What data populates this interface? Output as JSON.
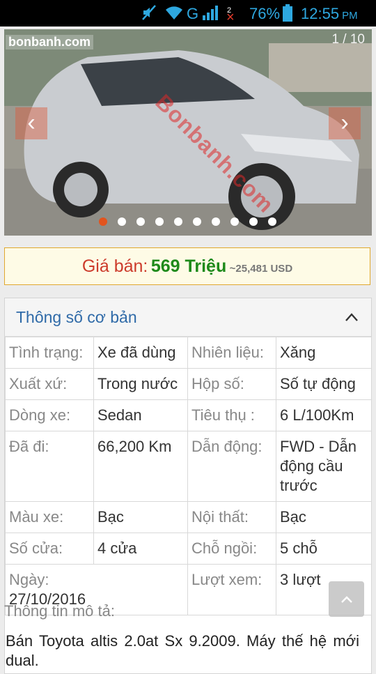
{
  "status": {
    "battery": "76%",
    "time": "12:55",
    "ampm": "PM",
    "network": "G",
    "sim_badge": "2"
  },
  "icons": {
    "mute": "volume-muted-icon",
    "wifi": "wifi-icon",
    "signal": "signal-bars-icon",
    "battery": "battery-icon",
    "prev": "chevron-left-icon",
    "next": "chevron-right-icon",
    "collapse": "chevron-up-icon",
    "scroll_top": "arrow-up-icon"
  },
  "gallery": {
    "counter": "1 / 10",
    "logo": "bonbanh.com",
    "watermark": "Bonbanh.com",
    "slide_count": 10,
    "active_slide": 1
  },
  "price": {
    "label": "Giá bán:",
    "value": "569 Triệu",
    "usd": "~25,481 USD"
  },
  "colors": {
    "accent_blue": "#2f6aa8",
    "price_green": "#1e8a1a",
    "label_red": "#cc3b2b",
    "active_dot": "#e2541e"
  },
  "specs": {
    "title": "Thông số cơ bản",
    "rows": [
      {
        "k1": "Tình trạng:",
        "v1": "Xe đã dùng",
        "k2": "Nhiên liệu:",
        "v2": "Xăng"
      },
      {
        "k1": "Xuất xứ:",
        "v1": "Trong nước",
        "k2": "Hộp số:",
        "v2": "Số tự động"
      },
      {
        "k1": "Dòng xe:",
        "v1": "Sedan",
        "k2": "Tiêu thụ :",
        "v2": "6 L/100Km"
      },
      {
        "k1": "Đã đi:",
        "v1": "66,200 Km",
        "k2": "Dẫn động:",
        "v2": "FWD - Dẫn động cầu trước"
      },
      {
        "k1": "Màu xe:",
        "v1": "Bạc",
        "k2": "Nội thất:",
        "v2": "Bạc"
      },
      {
        "k1": "Số cửa:",
        "v1": "4 cửa",
        "k2": "Chỗ ngồi:",
        "v2": "5 chỗ"
      },
      {
        "k1": "Ngày:",
        "v1": "27/10/2016",
        "k2": "Lượt xem:",
        "v2": "3 lượt"
      }
    ]
  },
  "description": {
    "label": "Thông tin mô tả:",
    "text": "Bán Toyota altis 2.0at Sx 9.2009. Máy thế hệ mới dual."
  }
}
